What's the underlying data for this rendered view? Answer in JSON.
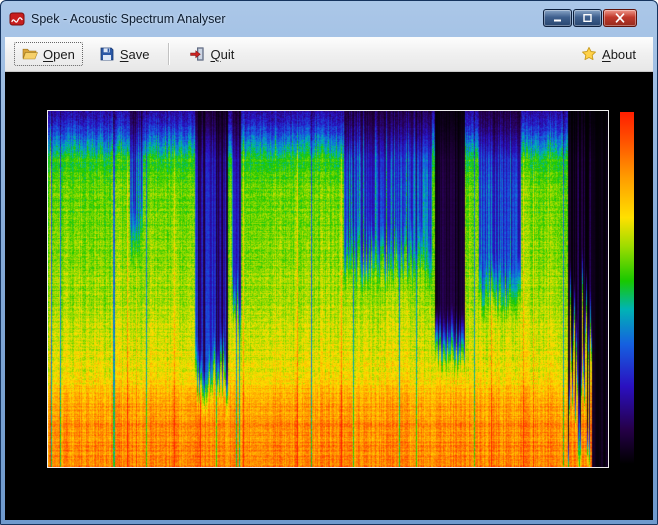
{
  "window": {
    "title": "Spek - Acoustic Spectrum Analyser"
  },
  "toolbar": {
    "open": {
      "key": "O",
      "rest": "pen"
    },
    "save": {
      "key": "S",
      "rest": "ave"
    },
    "quit": {
      "key": "Q",
      "rest": "uit"
    },
    "about": {
      "key": "A",
      "rest": "bout"
    }
  },
  "icons": {
    "app": "spek-red-waves",
    "open": "open-folder",
    "save": "floppy-disk",
    "quit": "exit-door-arrow",
    "about": "star",
    "minimize": "minimize-bar",
    "maximize": "maximize-square",
    "close": "close-x"
  },
  "colors": {
    "titlebar_top": "#abc7e8",
    "titlebar_bottom": "#6f9acd",
    "frame_border": "#15335e",
    "close_button": "#c0392b",
    "toolbar_bg": "#f0f0f0",
    "content_bg": "#000000",
    "focus_dotted": "#666666",
    "spectrogram_border": "#ededed"
  },
  "spectrogram": {
    "seed": 1337,
    "noise": 0.05,
    "col_noise": 0.07,
    "row_noise": 0.1,
    "palette_stops": [
      {
        "t": 0.0,
        "color": "#000000"
      },
      {
        "t": 0.1,
        "color": "#26004a"
      },
      {
        "t": 0.22,
        "color": "#2a10c0"
      },
      {
        "t": 0.34,
        "color": "#1560e0"
      },
      {
        "t": 0.44,
        "color": "#00b4b4"
      },
      {
        "t": 0.52,
        "color": "#18c800"
      },
      {
        "t": 0.62,
        "color": "#a0dc00"
      },
      {
        "t": 0.7,
        "color": "#ffe000"
      },
      {
        "t": 0.82,
        "color": "#ff9800"
      },
      {
        "t": 0.92,
        "color": "#ff5000"
      },
      {
        "t": 1.0,
        "color": "#ff1e00"
      }
    ],
    "base_profile": [
      [
        0.0,
        0.18
      ],
      [
        0.02,
        0.22
      ],
      [
        0.05,
        0.28
      ],
      [
        0.09,
        0.4
      ],
      [
        0.13,
        0.52
      ],
      [
        0.2,
        0.57
      ],
      [
        0.4,
        0.6
      ],
      [
        0.55,
        0.63
      ],
      [
        0.68,
        0.67
      ],
      [
        0.76,
        0.72
      ],
      [
        0.8,
        0.78
      ],
      [
        0.87,
        0.83
      ],
      [
        1.0,
        0.85
      ]
    ],
    "quiet_segments": [
      {
        "x0": 0.145,
        "x1": 0.168,
        "level": 0.55,
        "depth": 0.3,
        "jitter": 0.25,
        "depth_jitter": 0.1
      },
      {
        "x0": 0.262,
        "x1": 0.32,
        "level": 0.32,
        "depth": 0.72,
        "jitter": 0.22,
        "depth_jitter": 0.15
      },
      {
        "x0": 0.328,
        "x1": 0.344,
        "level": 0.5,
        "depth": 0.5,
        "jitter": 0.2,
        "depth_jitter": 0.1
      },
      {
        "x0": 0.528,
        "x1": 0.684,
        "level": 0.55,
        "depth": 0.38,
        "jitter": 0.26,
        "depth_jitter": 0.12
      },
      {
        "x0": 0.69,
        "x1": 0.744,
        "level": 0.1,
        "depth": 0.6,
        "jitter": 0.1,
        "depth_jitter": 0.08
      },
      {
        "x0": 0.768,
        "x1": 0.843,
        "level": 0.5,
        "depth": 0.46,
        "jitter": 0.2,
        "depth_jitter": 0.1
      },
      {
        "x0": 0.928,
        "x1": 0.97,
        "level": 0.08,
        "depth": 0.9,
        "jitter": 0.15,
        "depth_jitter": 0.55
      },
      {
        "x0": 0.97,
        "x1": 1.0,
        "level": 0.03,
        "depth": 1.0,
        "jitter": 0.04,
        "depth_jitter": 0.0
      }
    ]
  }
}
